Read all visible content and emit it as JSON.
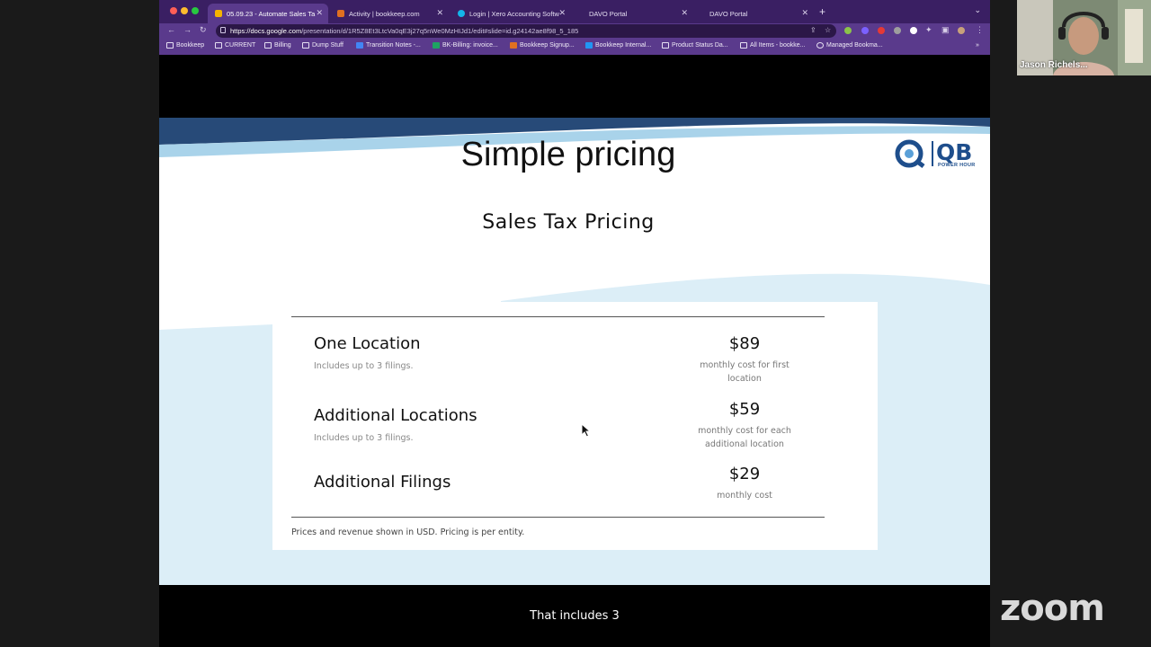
{
  "browser": {
    "tabs": [
      {
        "label": "05.09.23 - Automate Sales Ta",
        "active": true,
        "favicon_color": "#f4b400"
      },
      {
        "label": "Activity | bookkeep.com",
        "active": false,
        "favicon_color": "#e07020"
      },
      {
        "label": "Login | Xero Accounting Softw",
        "active": false,
        "favicon_color": "#13b5ea"
      },
      {
        "label": "DAVO Portal",
        "active": false,
        "favicon_color": ""
      },
      {
        "label": "DAVO Portal",
        "active": false,
        "favicon_color": ""
      }
    ],
    "url_host": "https://docs.google.com",
    "url_path": "/presentation/d/1R5Z8Et3LtcVa0qE3j27q5nWe0MzHIJd1/edit#slide=id.g24142ae8f98_5_185",
    "bookmarks": [
      "Bookkeep",
      "CURRENT",
      "Billing",
      "Dump Stuff",
      "Transition Notes -...",
      "BK-Billing: invoice...",
      "Bookkeep Signup...",
      "Bookkeep Internal...",
      "Product Status Da...",
      "All Items - bookke...",
      "Managed Bookma..."
    ]
  },
  "slide": {
    "title": "Simple pricing",
    "subtitle": "Sales Tax Pricing",
    "logo_text": "QB",
    "logo_tagline": "POWER HOUR",
    "plans": [
      {
        "name": "One Location",
        "desc": "Includes up to 3 filings.",
        "price": "$89",
        "price_note": "monthly cost for first location"
      },
      {
        "name": "Additional Locations",
        "desc": "Includes up to 3 filings.",
        "price": "$59",
        "price_note": "monthly cost for each additional location"
      },
      {
        "name": "Additional Filings",
        "desc": "",
        "price": "$29",
        "price_note": "monthly cost"
      }
    ],
    "footnote": "Prices and revenue shown in USD. Pricing is per entity."
  },
  "caption": "That includes 3",
  "participant": {
    "name": "Jason Richels..."
  },
  "zoom_logo": "zoom",
  "colors": {
    "tabbar": "#3a1f63",
    "toolbar": "#5a3a8c",
    "wave_dark": "#274a78",
    "wave_light": "#a9d3ea",
    "wave_pale": "#dceef7",
    "logo_blue": "#1e4e8c"
  }
}
